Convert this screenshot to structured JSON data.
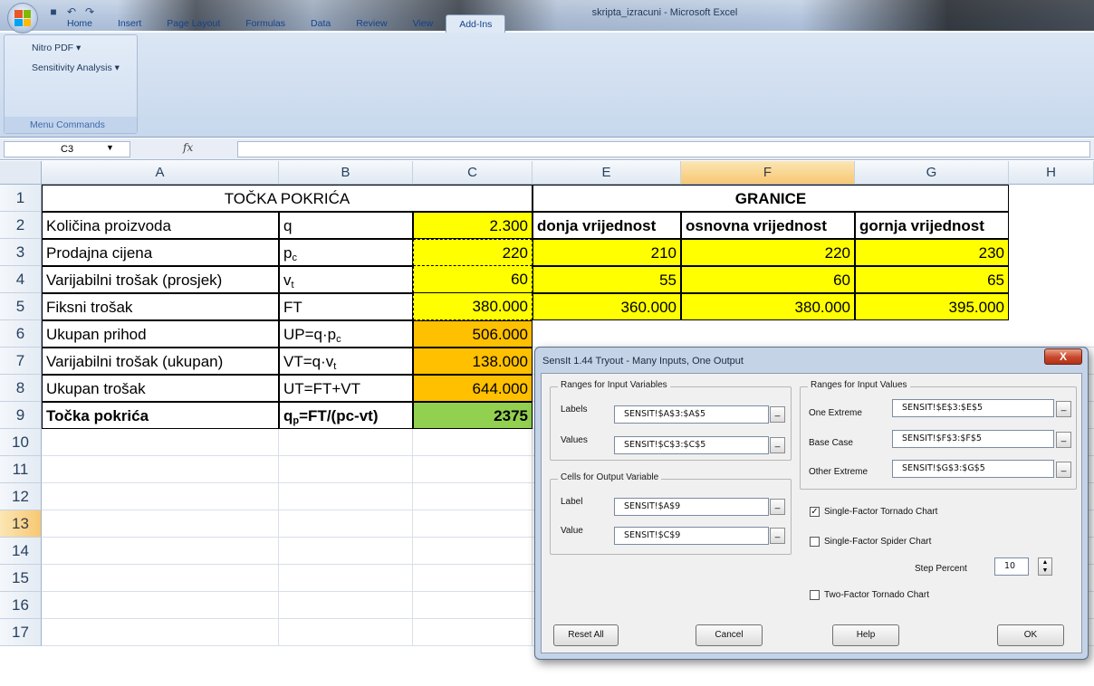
{
  "window": {
    "title": "skripta_izracuni - Microsoft Excel"
  },
  "ribbon": {
    "tabs": [
      "Home",
      "Insert",
      "Page Layout",
      "Formulas",
      "Data",
      "Review",
      "View",
      "Add-Ins"
    ],
    "active_tab": "Add-Ins",
    "group": {
      "items": [
        "Nitro PDF ▾",
        "Sensitivity Analysis ▾"
      ],
      "caption": "Menu Commands"
    }
  },
  "formula_bar": {
    "name_box": "C3",
    "fx": "fx",
    "formula": ""
  },
  "columns": [
    "A",
    "B",
    "C",
    "E",
    "F",
    "G",
    "H"
  ],
  "selected_column": "F",
  "rows": [
    "1",
    "2",
    "3",
    "4",
    "5",
    "6",
    "7",
    "8",
    "9",
    "10",
    "11",
    "12",
    "13",
    "14",
    "15",
    "16",
    "17"
  ],
  "selected_row": "13",
  "sheet": {
    "title_left": "TOČKA POKRIĆA",
    "title_right": "GRANICE",
    "headers": {
      "e": "donja vrijednost",
      "f": "osnovna vrijednost",
      "g": "gornja vrijednost"
    },
    "labels": [
      "Količina proizvoda",
      "Prodajna cijena",
      "Varijabilni trošak (prosjek)",
      "Fiksni trošak",
      "Ukupan prihod",
      "Varijabilni trošak (ukupan)",
      "Ukupan trošak",
      "Točka pokrića"
    ],
    "symbols": {
      "q": "q",
      "pc_main": "p",
      "pc_sub": "c",
      "vt_main": "v",
      "vt_sub": "t",
      "ft": "FT",
      "up_main": "UP=q·p",
      "up_sub": "c",
      "vtu_main": "VT=q·v",
      "vtu_sub": "t",
      "ut": "UT=FT+VT",
      "qp_main": "q",
      "qp_sub": "p",
      "qp_rest": "=FT/(pc-vt)"
    },
    "values": [
      "2.300",
      "220",
      "60",
      "380.000",
      "506.000",
      "138.000",
      "644.000",
      "2375"
    ],
    "ranges": [
      [
        "210",
        "220",
        "230"
      ],
      [
        "55",
        "60",
        "65"
      ],
      [
        "360.000",
        "380.000",
        "395.000"
      ]
    ]
  },
  "dialog": {
    "title": "SensIt 1.44 Tryout - Many Inputs, One Output",
    "close": "X",
    "input_vars": {
      "legend": "Ranges for Input Variables",
      "labels_label": "Labels",
      "labels_value": "SENSIT!$A$3:$A$5",
      "values_label": "Values",
      "values_value": "SENSIT!$C$3:$C$5"
    },
    "output_var": {
      "legend": "Cells for Output Variable",
      "label_label": "Label",
      "label_value": "SENSIT!$A$9",
      "value_label": "Value",
      "value_value": "SENSIT!$C$9"
    },
    "input_values": {
      "legend": "Ranges for Input Values",
      "one_label": "One Extreme",
      "one_value": "SENSIT!$E$3:$E$5",
      "base_label": "Base Case",
      "base_value": "SENSIT!$F$3:$F$5",
      "other_label": "Other Extreme",
      "other_value": "SENSIT!$G$3:$G$5"
    },
    "options": {
      "tornado": "Single-Factor Tornado Chart",
      "tornado_checked": "✓",
      "spider": "Single-Factor Spider Chart",
      "step_label": "Step Percent",
      "step_value": "10",
      "two_factor": "Two-Factor Tornado Chart"
    },
    "buttons": {
      "reset": "Reset All",
      "cancel": "Cancel",
      "help": "Help",
      "ok": "OK"
    },
    "range_button": "_"
  }
}
